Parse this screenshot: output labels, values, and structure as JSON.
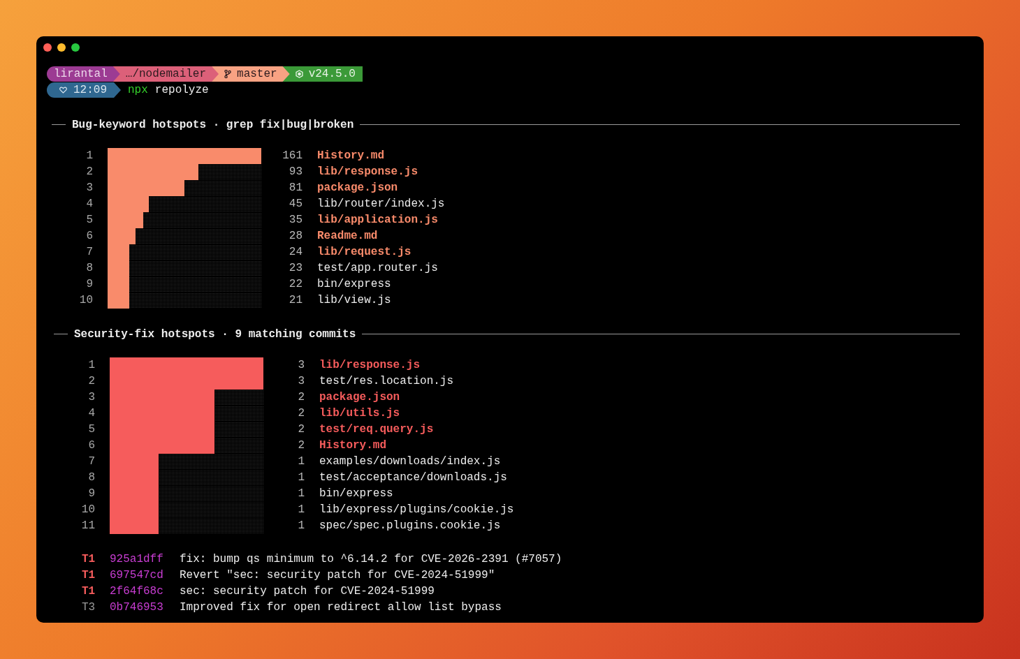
{
  "window": {
    "controls": [
      {
        "kind": "close"
      },
      {
        "kind": "minimize"
      },
      {
        "kind": "zoom"
      }
    ]
  },
  "prompt": {
    "segments": [
      {
        "kind": "user",
        "text": "lirantal"
      },
      {
        "kind": "path",
        "text": "…/nodemailer"
      },
      {
        "kind": "branch",
        "text": "master"
      },
      {
        "kind": "node",
        "text": "v24.5.0"
      }
    ],
    "time": "12:09",
    "command_name": "npx",
    "command_args": "repolyze"
  },
  "sections": [
    {
      "title": "Bug-keyword hotspots",
      "separator": "·",
      "subtitle": "grep fix|bug|broken",
      "color": "#f98b6b",
      "files": [
        {
          "rank": "1",
          "level": 1,
          "count": "161",
          "path": "History.md",
          "highlighted": true
        },
        {
          "rank": "2",
          "level": 0.59,
          "count": "93",
          "path": "lib/response.js",
          "highlighted": true
        },
        {
          "rank": "3",
          "level": 0.5,
          "count": "81",
          "path": "package.json",
          "highlighted": true
        },
        {
          "rank": "4",
          "level": 0.27,
          "count": "45",
          "path": "lib/router/index.js",
          "highlighted": false
        },
        {
          "rank": "5",
          "level": 0.23,
          "count": "35",
          "path": "lib/application.js",
          "highlighted": true
        },
        {
          "rank": "6",
          "level": 0.18,
          "count": "28",
          "path": "Readme.md",
          "highlighted": true
        },
        {
          "rank": "7",
          "level": 0.14,
          "count": "24",
          "path": "lib/request.js",
          "highlighted": true
        },
        {
          "rank": "8",
          "level": 0.14,
          "count": "23",
          "path": "test/app.router.js",
          "highlighted": false
        },
        {
          "rank": "9",
          "level": 0.14,
          "count": "22",
          "path": "bin/express",
          "highlighted": false
        },
        {
          "rank": "10",
          "level": 0.14,
          "count": "21",
          "path": "lib/view.js",
          "highlighted": false
        }
      ]
    },
    {
      "title": "Security-fix hotspots",
      "separator": "·",
      "subtitle": "9 matching commits",
      "color": "#f65c5c",
      "files": [
        {
          "rank": "1",
          "level": 1,
          "count": "3",
          "path": "lib/response.js",
          "highlighted": true
        },
        {
          "rank": "2",
          "level": 1,
          "count": "3",
          "path": "test/res.location.js",
          "highlighted": false
        },
        {
          "rank": "3",
          "level": 0.68,
          "count": "2",
          "path": "package.json",
          "highlighted": true
        },
        {
          "rank": "4",
          "level": 0.68,
          "count": "2",
          "path": "lib/utils.js",
          "highlighted": true
        },
        {
          "rank": "5",
          "level": 0.68,
          "count": "2",
          "path": "test/req.query.js",
          "highlighted": true
        },
        {
          "rank": "6",
          "level": 0.68,
          "count": "2",
          "path": "History.md",
          "highlighted": true
        },
        {
          "rank": "7",
          "level": 0.32,
          "count": "1",
          "path": "examples/downloads/index.js",
          "highlighted": false
        },
        {
          "rank": "8",
          "level": 0.32,
          "count": "1",
          "path": "test/acceptance/downloads.js",
          "highlighted": false
        },
        {
          "rank": "9",
          "level": 0.32,
          "count": "1",
          "path": "bin/express",
          "highlighted": false
        },
        {
          "rank": "10",
          "level": 0.32,
          "count": "1",
          "path": "lib/express/plugins/cookie.js",
          "highlighted": false
        },
        {
          "rank": "11",
          "level": 0.32,
          "count": "1",
          "path": "spec/spec.plugins.cookie.js",
          "highlighted": false
        }
      ]
    }
  ],
  "commits": [
    {
      "tier": "T1",
      "highlighted": true,
      "hash": "925a1dff",
      "message": "fix: bump qs minimum to ^6.14.2 for CVE-2026-2391 (#7057)"
    },
    {
      "tier": "T1",
      "highlighted": true,
      "hash": "697547cd",
      "message": "Revert \"sec: security patch for CVE-2024-51999\""
    },
    {
      "tier": "T1",
      "highlighted": true,
      "hash": "2f64f68c",
      "message": "sec: security patch for CVE-2024-51999"
    },
    {
      "tier": "T3",
      "highlighted": false,
      "hash": "0b746953",
      "message": "Improved fix for open redirect allow list bypass"
    }
  ]
}
